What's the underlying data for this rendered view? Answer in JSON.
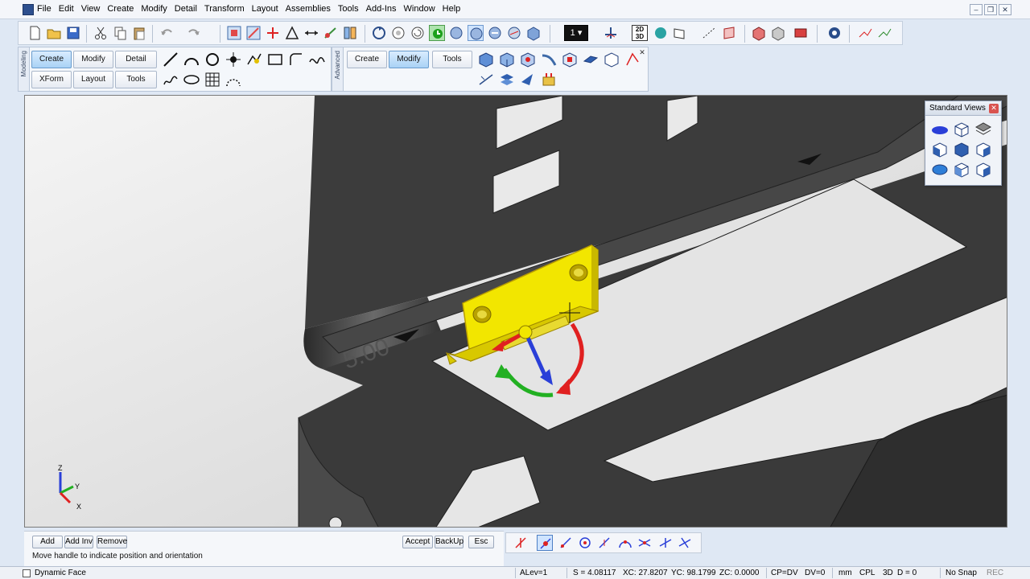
{
  "menubar": {
    "items": [
      "File",
      "Edit",
      "View",
      "Create",
      "Modify",
      "Detail",
      "Transform",
      "Layout",
      "Assemblies",
      "Tools",
      "Add-Ins",
      "Window",
      "Help"
    ]
  },
  "toolbar": {
    "level_value": "1"
  },
  "modeling_panel": {
    "tab_label": "Modeling",
    "buttons": [
      "Create",
      "Modify",
      "Detail",
      "XForm",
      "Layout",
      "Tools"
    ]
  },
  "advanced_panel": {
    "tab_label": "Advanced",
    "buttons": [
      "Create",
      "Modify",
      "Tools"
    ]
  },
  "standard_views": {
    "title": "Standard Views"
  },
  "viewport": {
    "dimension_text": "5.00",
    "axis_labels": [
      "Z",
      "Y",
      "X"
    ]
  },
  "prompt": {
    "left_buttons": [
      "Add",
      "Add Inv",
      "Remove"
    ],
    "right_buttons": [
      "Accept",
      "BackUp",
      "Esc"
    ],
    "message": "Move handle to indicate position and orientation"
  },
  "statusbar": {
    "mode": "Dynamic Face",
    "alev": "ALev=1",
    "scale": "S = 4.08117",
    "xc": "XC: 27.8207",
    "yc": "YC: 98.1799",
    "zc": "ZC: 0.0000",
    "cp": "CP=DV",
    "dv": "DV=0",
    "units": "mm",
    "cpl": "CPL",
    "mode3d": "3D",
    "depth": "D = 0",
    "snap": "No Snap",
    "rec": "REC"
  },
  "colors": {
    "highlight_yellow": "#f2e600",
    "handle_red": "#e02020",
    "handle_green": "#22b022",
    "handle_blue": "#2a3fd8",
    "part_dark": "#3b3b3b"
  }
}
